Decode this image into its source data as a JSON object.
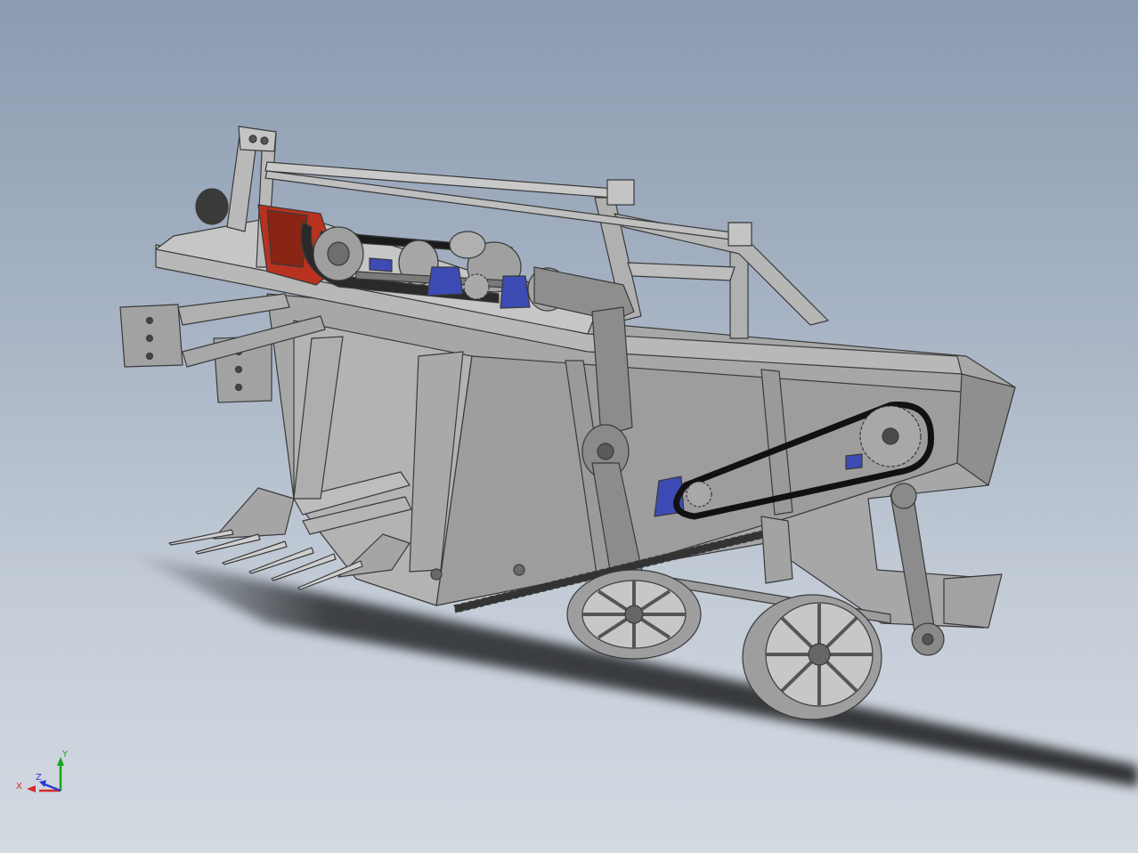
{
  "viewport": {
    "background_top": "#8b9bb0",
    "background_bottom": "#d4dae2"
  },
  "model": {
    "part_color": "#a9a9aa",
    "edge_color": "#3a3a3a",
    "bearing_color": "#3d4bb4",
    "gearbox_color": "#b8321f",
    "chain_color": "#1a1a1a"
  },
  "triad": {
    "x_label": "X",
    "y_label": "Y",
    "z_label": "Z",
    "x_color": "#d42a2a",
    "y_color": "#1aa51a",
    "z_color": "#2a3ad4"
  }
}
